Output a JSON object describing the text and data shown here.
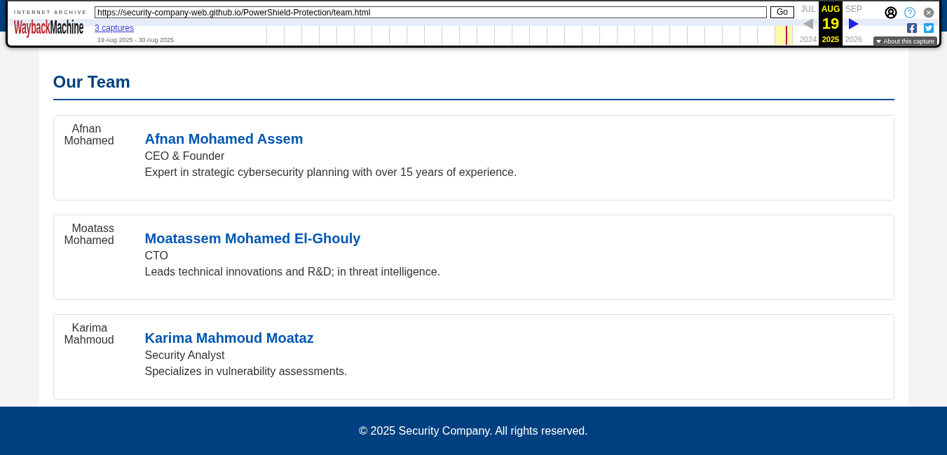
{
  "wayback": {
    "logo": {
      "caption": "INTERNET ARCHIVE",
      "parts": [
        "Wayback",
        "Machine"
      ]
    },
    "url": {
      "value": "https://security-company-web.github.io/PowerShield-Protection/team.html"
    },
    "go_button": "Go",
    "captures_link": "3 captures",
    "date_range": "19 Aug 2025 - 30 Aug 2025",
    "calendar": {
      "months": [
        {
          "label": "JUL",
          "year": "2024",
          "selected": false
        },
        {
          "label": "AUG",
          "day": "19",
          "year": "2025",
          "selected": true
        },
        {
          "label": "SEP",
          "year": "2026",
          "selected": false
        }
      ],
      "prev": {
        "disabled": true
      },
      "next": {
        "disabled": false
      }
    },
    "about_button": "About this capture"
  },
  "page": {
    "title": "Our Team",
    "members": [
      {
        "alt": "Afnan Mohamed",
        "name": "Afnan Mohamed Assem",
        "role": "CEO & Founder",
        "bio": "Expert in strategic cybersecurity planning with over 15 years of experience."
      },
      {
        "alt": "Moatass Mohamed",
        "name": "Moatassem Mohamed El-Ghouly",
        "role": "CTO",
        "bio": "Leads technical innovations and R&D; in threat intelligence."
      },
      {
        "alt": "Karima Mahmoud",
        "name": "Karima Mahmoud Moataz",
        "role": "Security Analyst",
        "bio": "Specializes in vulnerability assessments."
      }
    ]
  },
  "footer": {
    "text": "© 2025 Security Company. All rights reserved."
  }
}
